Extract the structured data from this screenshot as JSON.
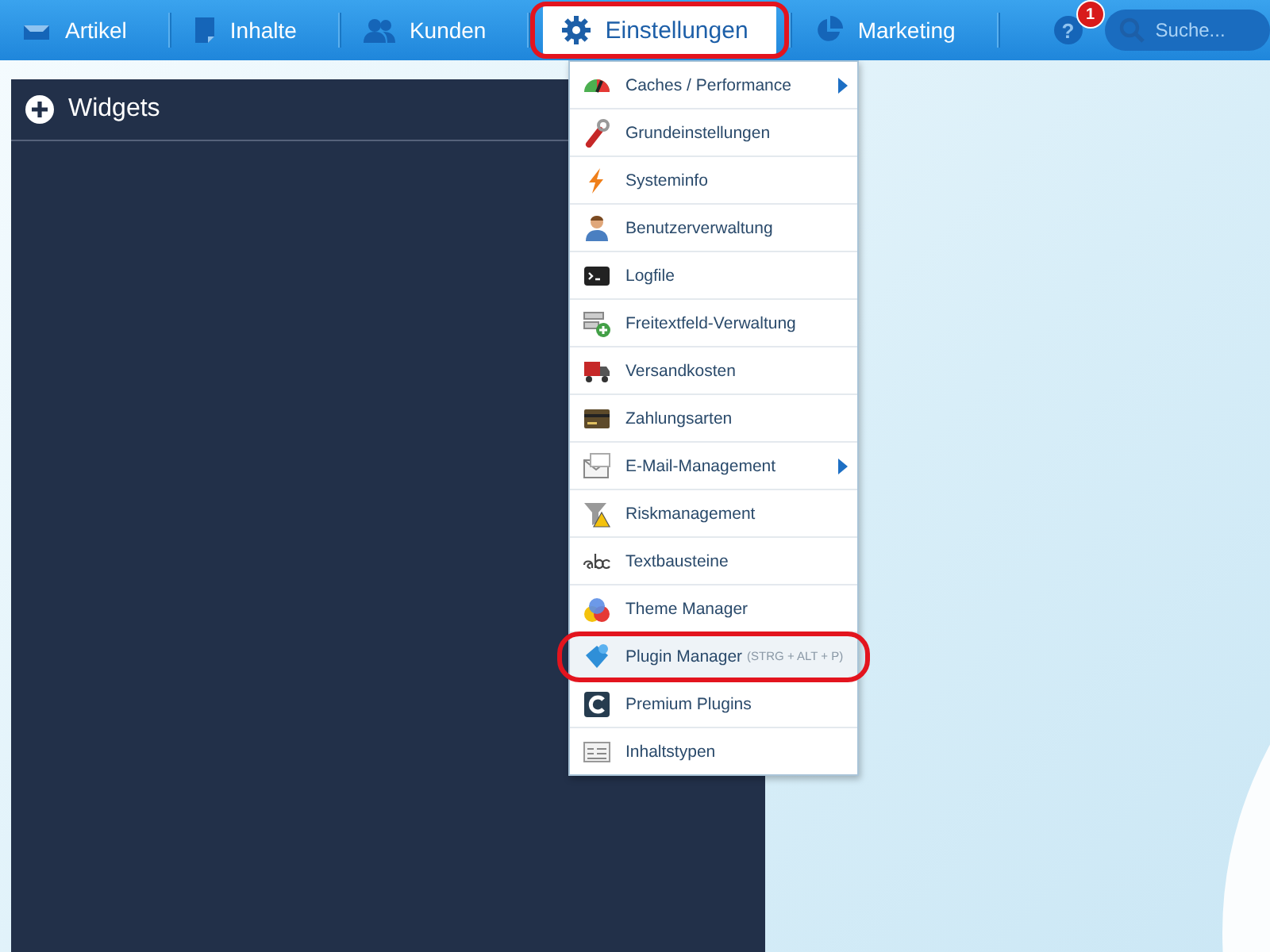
{
  "nav": [
    {
      "label": "Artikel",
      "selected": false,
      "circled": false
    },
    {
      "label": "Inhalte",
      "selected": false,
      "circled": false
    },
    {
      "label": "Kunden",
      "selected": false,
      "circled": false
    },
    {
      "label": "Einstellungen",
      "selected": true,
      "circled": true
    },
    {
      "label": "Marketing",
      "selected": false,
      "circled": false
    }
  ],
  "help": "?",
  "notification_badge": "1",
  "search": {
    "placeholder": "Suche..."
  },
  "widgets_panel": {
    "title": "Widgets"
  },
  "menu": [
    {
      "label": "Caches / Performance",
      "submenu": true,
      "hovered": false,
      "circled": false
    },
    {
      "label": "Grundeinstellungen",
      "submenu": false,
      "hovered": false,
      "circled": false
    },
    {
      "label": "Systeminfo",
      "submenu": false,
      "hovered": false,
      "circled": false
    },
    {
      "label": "Benutzerverwaltung",
      "submenu": false,
      "hovered": false,
      "circled": false
    },
    {
      "label": "Logfile",
      "submenu": false,
      "hovered": false,
      "circled": false
    },
    {
      "label": "Freitextfeld-Verwaltung",
      "submenu": false,
      "hovered": false,
      "circled": false
    },
    {
      "label": "Versandkosten",
      "submenu": false,
      "hovered": false,
      "circled": false
    },
    {
      "label": "Zahlungsarten",
      "submenu": false,
      "hovered": false,
      "circled": false
    },
    {
      "label": "E-Mail-Management",
      "submenu": true,
      "hovered": false,
      "circled": false
    },
    {
      "label": "Riskmanagement",
      "submenu": false,
      "hovered": false,
      "circled": false
    },
    {
      "label": "Textbausteine",
      "submenu": false,
      "hovered": false,
      "circled": false
    },
    {
      "label": "Theme Manager",
      "submenu": false,
      "hovered": false,
      "circled": false
    },
    {
      "label": "Plugin Manager",
      "shortcut": "(STRG + ALT + P)",
      "submenu": false,
      "hovered": true,
      "circled": true
    },
    {
      "label": "Premium Plugins",
      "submenu": false,
      "hovered": false,
      "circled": false
    },
    {
      "label": "Inhaltstypen",
      "submenu": false,
      "hovered": false,
      "circled": false
    }
  ]
}
